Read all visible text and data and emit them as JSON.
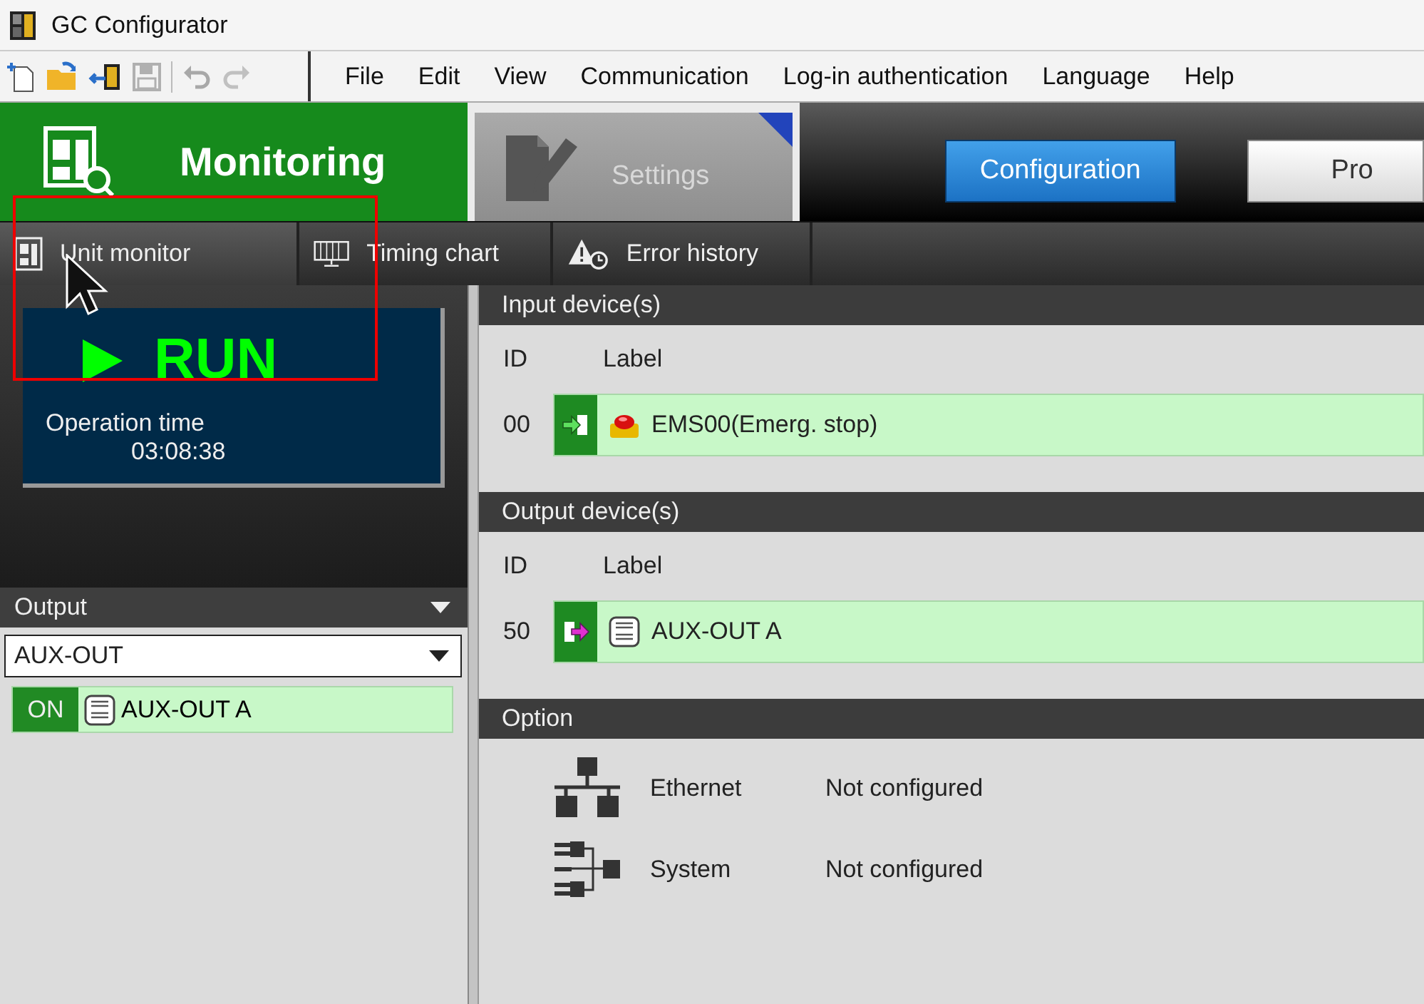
{
  "window": {
    "title": "GC Configurator"
  },
  "toolbar": [
    {
      "kind": "new",
      "disabled": false
    },
    {
      "kind": "open",
      "disabled": false
    },
    {
      "kind": "import",
      "disabled": false
    },
    {
      "kind": "save",
      "disabled": true
    },
    {
      "kind": "undo",
      "disabled": true
    },
    {
      "kind": "redo",
      "disabled": true
    }
  ],
  "menu": [
    "File",
    "Edit",
    "View",
    "Communication",
    "Log-in authentication",
    "Language",
    "Help"
  ],
  "modes": [
    {
      "label": "Monitoring",
      "selected": true
    },
    {
      "label": "Settings",
      "selected": false
    }
  ],
  "mode_buttons": [
    {
      "label": "Configuration",
      "selected": true
    },
    {
      "label": "Pro",
      "selected": false
    }
  ],
  "subtabs": [
    {
      "kind": "unit",
      "label": "Unit monitor",
      "selected": true
    },
    {
      "kind": "timing",
      "label": "Timing chart",
      "selected": false
    },
    {
      "kind": "error",
      "label": "Error history",
      "selected": false
    }
  ],
  "status": {
    "state": "RUN",
    "running": true,
    "time_label": "Operation time",
    "time": "03:08:38"
  },
  "output_panel": {
    "title": "Output",
    "dropdown": "AUX-OUT",
    "items": [
      {
        "state": "ON",
        "on": true,
        "label": "AUX-OUT A"
      }
    ]
  },
  "sections": [
    {
      "title": "Input device(s)",
      "columns": [
        "ID",
        "Label"
      ],
      "rows": [
        {
          "id": "00",
          "kind": "estop_input",
          "label": "EMS00(Emerg. stop)"
        }
      ]
    },
    {
      "title": "Output device(s)",
      "columns": [
        "ID",
        "Label"
      ],
      "rows": [
        {
          "id": "50",
          "kind": "aux_output",
          "label": "AUX-OUT A"
        }
      ]
    }
  ],
  "options": {
    "title": "Option",
    "items": [
      {
        "kind": "network",
        "name": "Ethernet",
        "value": "Not configured"
      },
      {
        "kind": "system",
        "name": "System",
        "value": "Not configured"
      }
    ]
  }
}
